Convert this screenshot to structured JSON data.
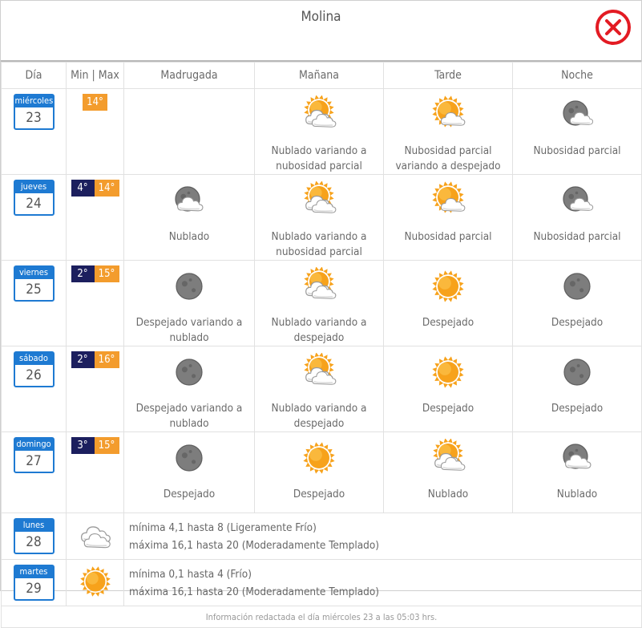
{
  "title": "Molina",
  "headers": [
    "Día",
    "Min | Max",
    "Madrugada",
    "Mañana",
    "Tarde",
    "Noche"
  ],
  "days": [
    {
      "dayname": "miércoles",
      "daynum": "23",
      "min": "",
      "max": "14°",
      "periods": [
        {
          "icon": "",
          "text": ""
        },
        {
          "icon": "sun-clouds",
          "text": "Nublado variando a nubosidad parcial"
        },
        {
          "icon": "sun-cloud",
          "text": "Nubosidad parcial variando a despejado"
        },
        {
          "icon": "moon-cloud",
          "text": "Nubosidad parcial"
        }
      ]
    },
    {
      "dayname": "jueves",
      "daynum": "24",
      "min": "4°",
      "max": "14°",
      "periods": [
        {
          "icon": "moon-clouds",
          "text": "Nublado"
        },
        {
          "icon": "sun-clouds",
          "text": "Nublado variando a nubosidad parcial"
        },
        {
          "icon": "sun-cloud",
          "text": "Nubosidad parcial"
        },
        {
          "icon": "moon-cloud",
          "text": "Nubosidad parcial"
        }
      ]
    },
    {
      "dayname": "viernes",
      "daynum": "25",
      "min": "2°",
      "max": "15°",
      "periods": [
        {
          "icon": "moon",
          "text": "Despejado variando a nublado"
        },
        {
          "icon": "sun-clouds",
          "text": "Nublado variando a despejado"
        },
        {
          "icon": "sun",
          "text": "Despejado"
        },
        {
          "icon": "moon",
          "text": "Despejado"
        }
      ]
    },
    {
      "dayname": "sábado",
      "daynum": "26",
      "min": "2°",
      "max": "16°",
      "periods": [
        {
          "icon": "moon",
          "text": "Despejado variando a nublado"
        },
        {
          "icon": "sun-clouds",
          "text": "Nublado variando a despejado"
        },
        {
          "icon": "sun",
          "text": "Despejado"
        },
        {
          "icon": "moon",
          "text": "Despejado"
        }
      ]
    },
    {
      "dayname": "domingo",
      "daynum": "27",
      "min": "3°",
      "max": "15°",
      "periods": [
        {
          "icon": "moon",
          "text": "Despejado"
        },
        {
          "icon": "sun",
          "text": "Despejado"
        },
        {
          "icon": "sun-clouds",
          "text": "Nublado"
        },
        {
          "icon": "moon-clouds",
          "text": "Nublado"
        }
      ]
    }
  ],
  "extended": [
    {
      "dayname": "lunes",
      "daynum": "28",
      "icon": "clouds",
      "line1": "mínima 4,1 hasta 8 (Ligeramente Frío)",
      "line2": "máxima 16,1 hasta 20 (Moderadamente Templado)"
    },
    {
      "dayname": "martes",
      "daynum": "29",
      "icon": "sun",
      "line1": "mínima 0,1 hasta 4 (Frío)",
      "line2": "máxima 16,1 hasta 20 (Moderadamente Templado)"
    }
  ],
  "footer": "Información redactada el día miércoles 23 a las 05:03 hrs.",
  "colors": {
    "accent_blue": "#1e7ad2",
    "min_bg": "#1c1f5e",
    "max_bg": "#f39c2d",
    "close_red": "#e31b23",
    "sun": "#f7a21b",
    "moon": "#8a8a8a"
  }
}
